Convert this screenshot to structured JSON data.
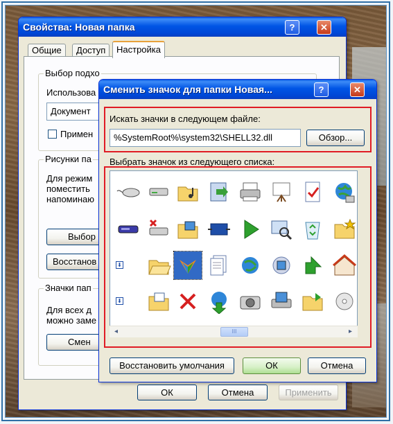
{
  "colors": {
    "title_bar": "#0055e5",
    "highlight": "#e01b24",
    "selection": "#316ac5"
  },
  "props_window": {
    "title": "Свойства: Новая папка",
    "help_button": "?",
    "close_button": "✕",
    "tabs": [
      "Общие",
      "Доступ",
      "Настройка"
    ],
    "group1_label": "Выбор подхо",
    "group1_text": "Использова",
    "combo_value": "Документ",
    "checkbox_label": "Примен",
    "group2_label": "Рисунки па",
    "group2_text": [
      "Для режим",
      "поместить",
      "напоминаю"
    ],
    "choose_button": "Выбор",
    "restore_button": "Восстанов",
    "group3_label": "Значки пап",
    "group3_text": [
      "Для всех д",
      "можно заме"
    ],
    "change_button": "Смен",
    "ok_button": "ОК",
    "cancel_button": "Отмена",
    "apply_button": "Применить"
  },
  "change_icon_dialog": {
    "title": "Сменить значок для папки Новая...",
    "help_button": "?",
    "close_button": "✕",
    "file_label": "Искать значки в следующем файле:",
    "file_path": "%SystemRoot%\\system32\\SHELL32.dll",
    "browse_button": "Обзор...",
    "list_label": "Выбрать значок из следующего списка:",
    "restore_defaults_button": "Восстановить умолчания",
    "ok_button": "ОК",
    "cancel_button": "Отмена",
    "scroll_left": "◂",
    "scroll_right": "▸",
    "scroll_thumb": "III",
    "row_marker": "⬇",
    "icons": [
      [
        "mouse-icon",
        "drive-icon",
        "music-folder-icon",
        "program-install-icon",
        "printer-icon",
        "presentation-board-icon",
        "document-check-icon",
        "network-globe-icon"
      ],
      [
        "removable-disk-icon",
        "disconnected-drive-icon",
        "picture-folder-icon",
        "display-resize-icon",
        "play-icon",
        "search-magnifier-icon",
        "recycle-bin-icon",
        "favorites-folder-icon"
      ],
      [
        "empty-slot",
        "open-folder-icon",
        "msn-butterfly-icon",
        "document-stack-icon",
        "internet-explorer-globe-icon",
        "picture-cd-icon",
        "green-arrow-icon",
        "home-network-icon"
      ],
      [
        "empty-slot",
        "folder-picture-icon",
        "delete-x-icon",
        "globe-arrow-icon",
        "camera-icon",
        "printer-picture-icon",
        "shared-folder-icon",
        "cd-audio-icon"
      ]
    ]
  }
}
